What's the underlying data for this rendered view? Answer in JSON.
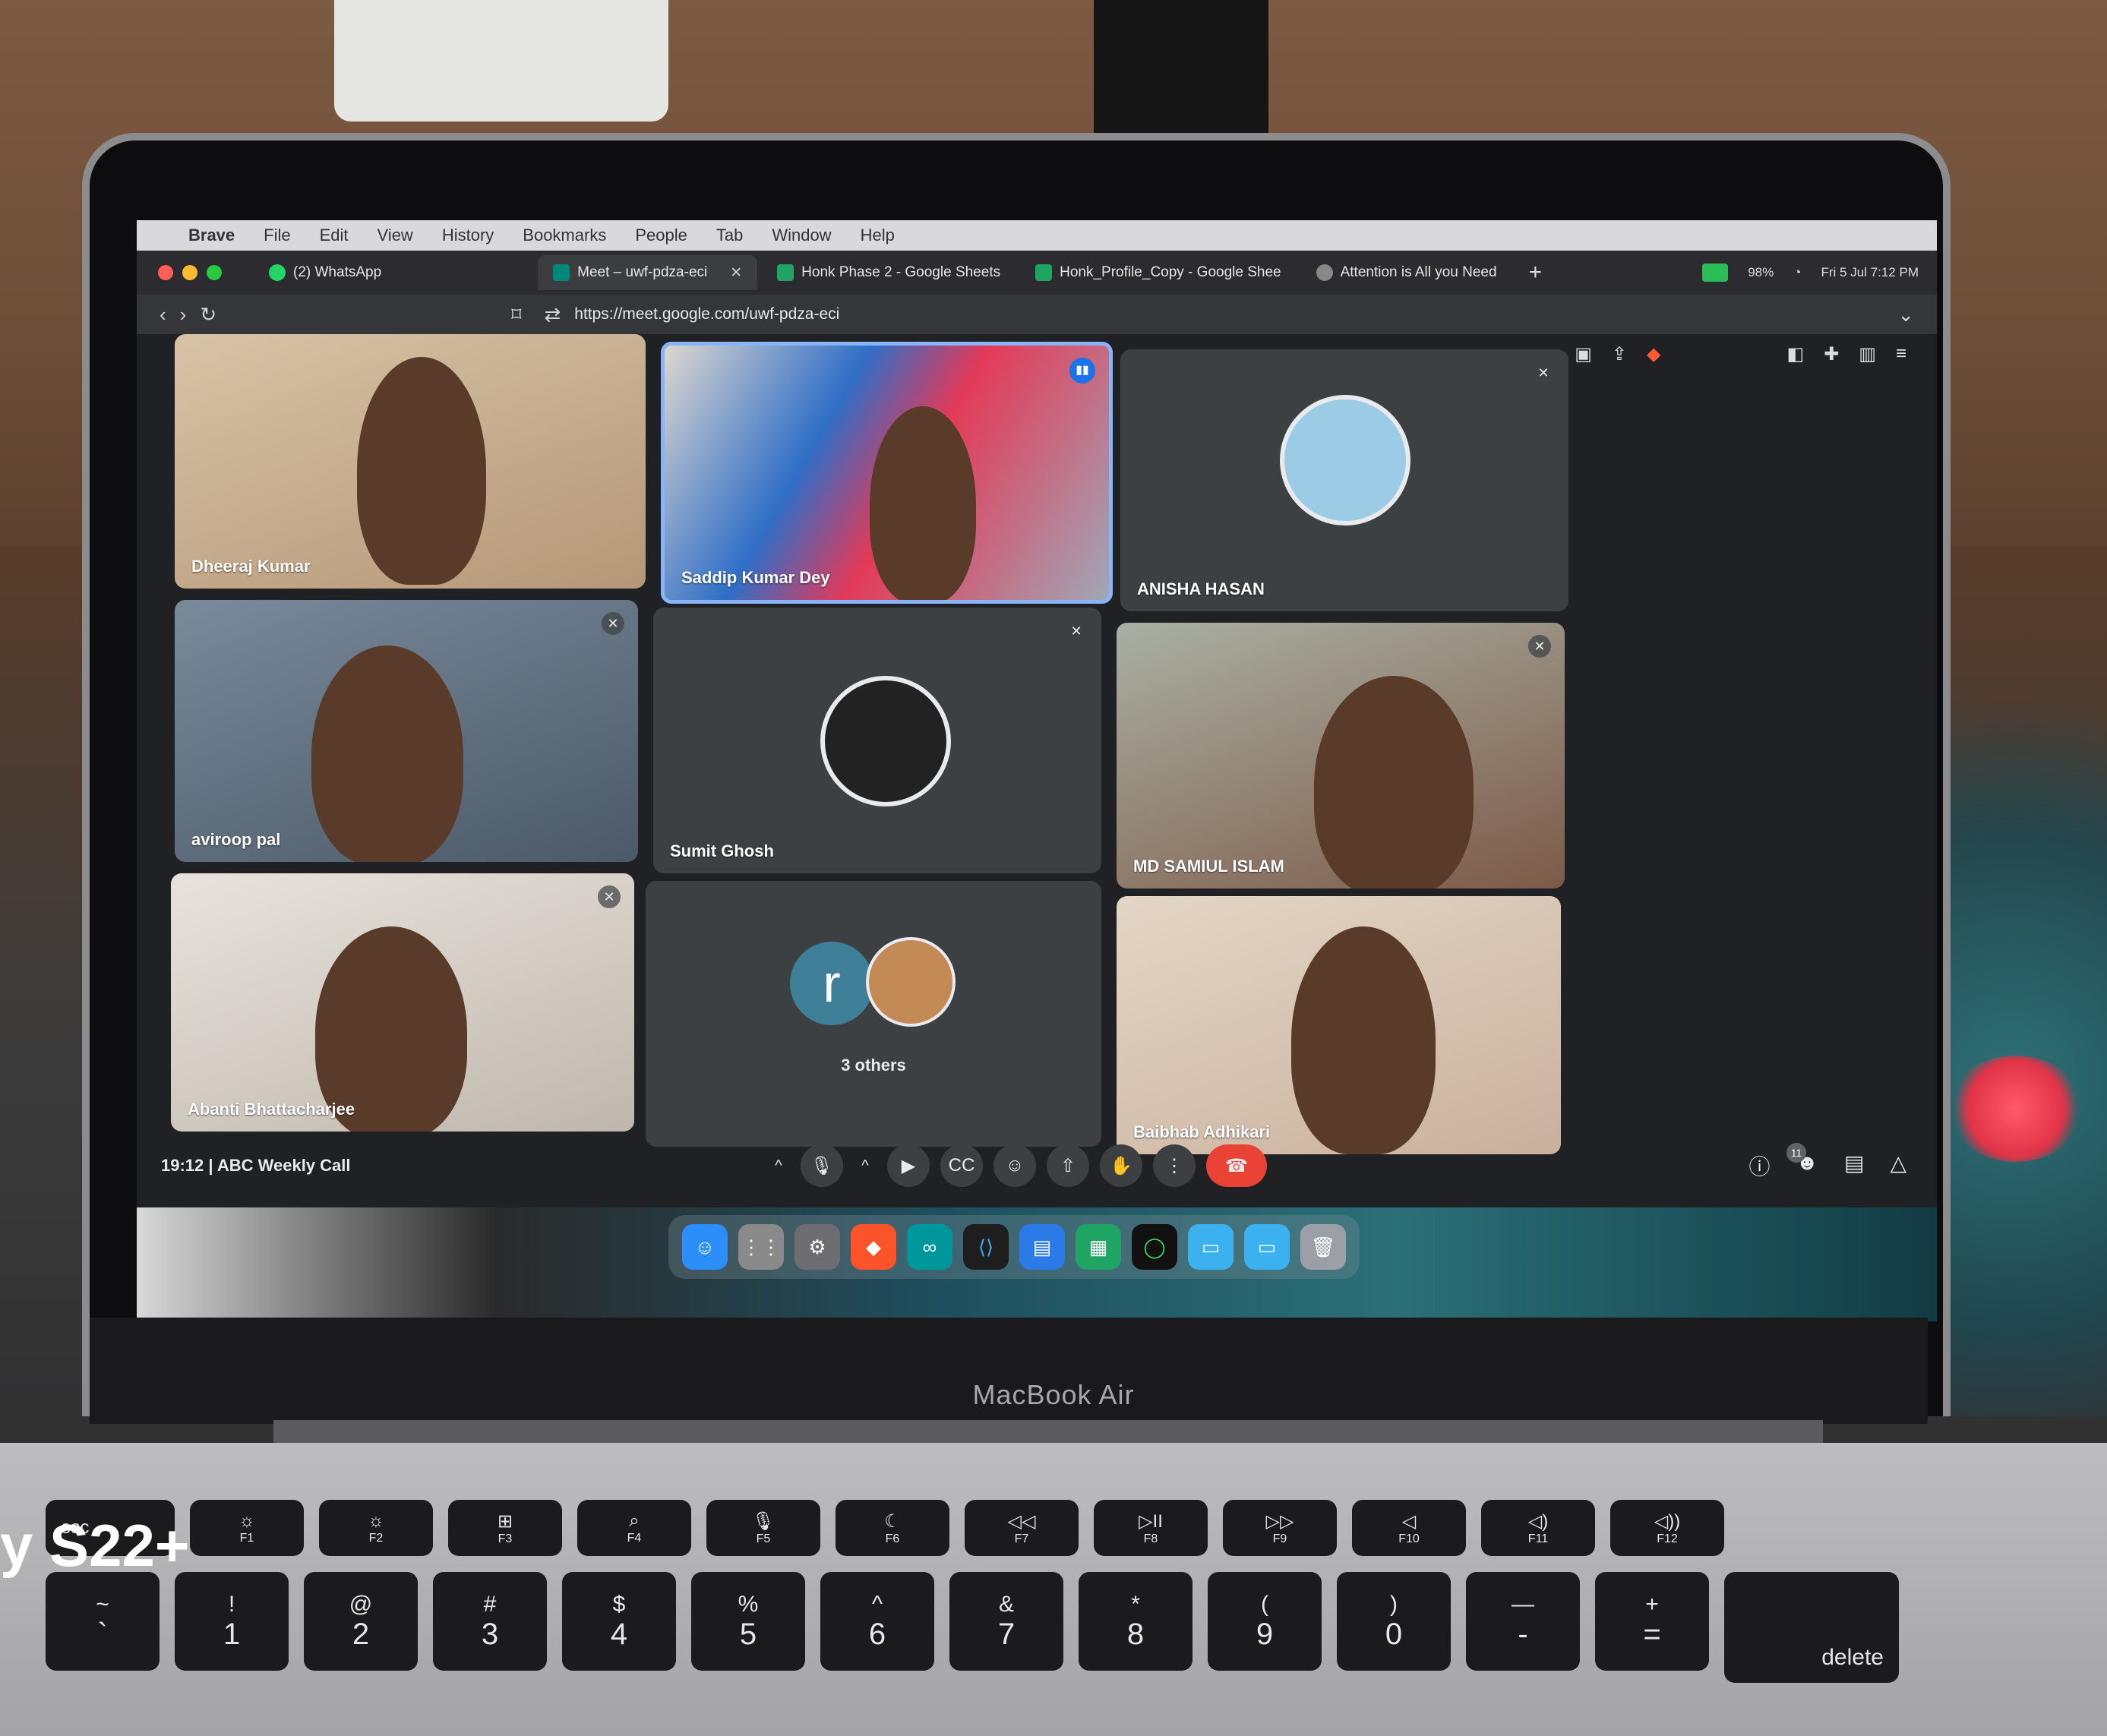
{
  "menubar": {
    "app_name": "Brave",
    "items": [
      "File",
      "Edit",
      "View",
      "History",
      "Bookmarks",
      "People",
      "Tab",
      "Window",
      "Help"
    ]
  },
  "tabs": [
    {
      "title": "(2) WhatsApp",
      "active": false
    },
    {
      "title": "Meet – uwf-pdza-eci",
      "active": true
    },
    {
      "title": "Honk Phase 2 - Google Sheets",
      "active": false
    },
    {
      "title": "Honk_Profile_Copy - Google Shee",
      "active": false
    },
    {
      "title": "Attention is All you Need",
      "active": false
    }
  ],
  "status": {
    "battery": "98%",
    "datetime": "Fri 5 Jul  7:12 PM"
  },
  "address_bar": {
    "url": "https://meet.google.com/uwf-pdza-eci"
  },
  "participants": [
    {
      "name": "Dheeraj Kumar"
    },
    {
      "name": "Saddip Kumar Dey"
    },
    {
      "name": "ANISHA HASAN"
    },
    {
      "name": "aviroop pal"
    },
    {
      "name": "Sumit Ghosh"
    },
    {
      "name": "MD SAMIUL ISLAM"
    },
    {
      "name": "Abanti Bhattacharjee"
    },
    {
      "name": "3 others",
      "avatar_letter": "r"
    },
    {
      "name": "Baibhab Adhikari"
    }
  ],
  "meeting": {
    "time": "19:12",
    "separator": "|",
    "title": "ABC Weekly Call",
    "participant_count": "11"
  },
  "colors": {
    "meet_bg": "#202124",
    "tile_bg": "#3c4043",
    "end_call": "#ea4335",
    "speaking_border": "#8ab4f8"
  },
  "icons": {
    "controls": [
      "caret-up",
      "mic",
      "caret-up",
      "camera",
      "captions",
      "emoji",
      "present",
      "raise-hand",
      "more",
      "end-call"
    ],
    "right_controls": [
      "info",
      "people",
      "chat",
      "activities"
    ]
  },
  "laptop": {
    "brand": "MacBook Air"
  },
  "watermark": "y S22+",
  "keyboard": {
    "fn_row": [
      {
        "label": "esc",
        "sub": ""
      },
      {
        "label": "☼",
        "sub": "F1"
      },
      {
        "label": "☼",
        "sub": "F2"
      },
      {
        "label": "⊞",
        "sub": "F3"
      },
      {
        "label": "⌕",
        "sub": "F4"
      },
      {
        "label": "🎙",
        "sub": "F5"
      },
      {
        "label": "☾",
        "sub": "F6"
      },
      {
        "label": "◁◁",
        "sub": "F7"
      },
      {
        "label": "▷II",
        "sub": "F8"
      },
      {
        "label": "▷▷",
        "sub": "F9"
      },
      {
        "label": "◁",
        "sub": "F10"
      },
      {
        "label": "◁)",
        "sub": "F11"
      },
      {
        "label": "◁))",
        "sub": "F12"
      }
    ],
    "num_row": [
      {
        "top": "~",
        "bot": "`"
      },
      {
        "top": "!",
        "bot": "1"
      },
      {
        "top": "@",
        "bot": "2"
      },
      {
        "top": "#",
        "bot": "3"
      },
      {
        "top": "$",
        "bot": "4"
      },
      {
        "top": "%",
        "bot": "5"
      },
      {
        "top": "^",
        "bot": "6"
      },
      {
        "top": "&",
        "bot": "7"
      },
      {
        "top": "*",
        "bot": "8"
      },
      {
        "top": "(",
        "bot": "9"
      },
      {
        "top": ")",
        "bot": "0"
      },
      {
        "top": "—",
        "bot": "-"
      },
      {
        "top": "+",
        "bot": "="
      }
    ],
    "delete_label": "delete"
  }
}
